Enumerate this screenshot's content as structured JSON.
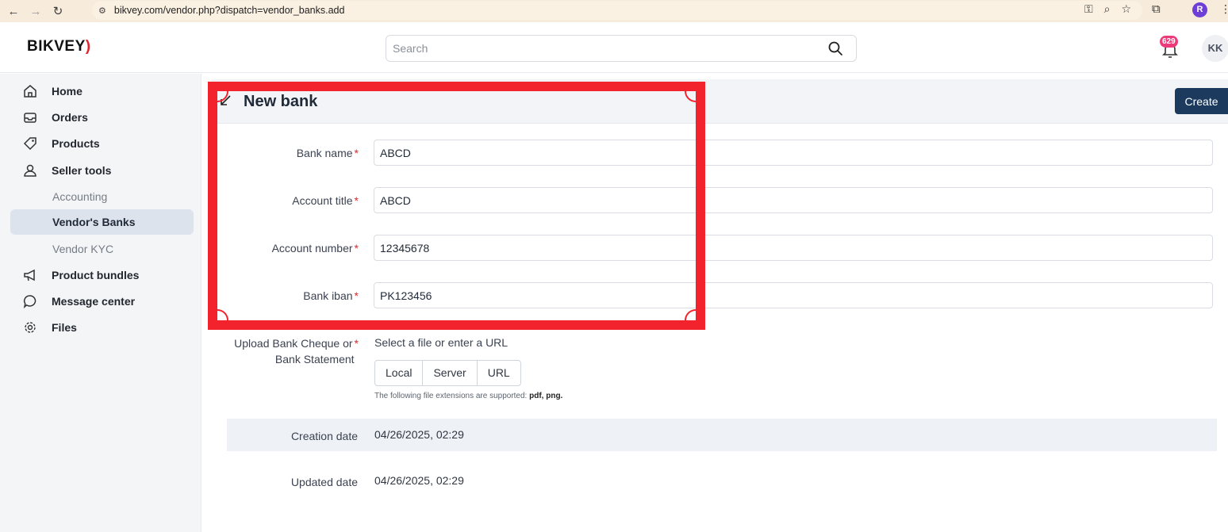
{
  "browser": {
    "url": "bikvey.com/vendor.php?dispatch=vendor_banks.add",
    "profile_initial": "R"
  },
  "header": {
    "logo_text": "BIKVEY",
    "search_placeholder": "Search",
    "notification_count": "629",
    "avatar_initials": "KK"
  },
  "sidebar": {
    "items": [
      {
        "label": "Home",
        "icon": "home-icon"
      },
      {
        "label": "Orders",
        "icon": "inbox-icon"
      },
      {
        "label": "Products",
        "icon": "tag-icon"
      },
      {
        "label": "Seller tools",
        "icon": "user-icon"
      },
      {
        "label": "Accounting"
      },
      {
        "label": "Vendor's Banks",
        "active": true
      },
      {
        "label": "Vendor KYC"
      },
      {
        "label": "Product bundles",
        "icon": "megaphone-icon"
      },
      {
        "label": "Message center",
        "icon": "chat-icon"
      },
      {
        "label": "Files",
        "icon": "gear-icon"
      }
    ]
  },
  "page": {
    "title": "New bank",
    "create_label": "Create"
  },
  "form": {
    "bank_name": {
      "label": "Bank name",
      "value": "ABCD"
    },
    "account_title": {
      "label": "Account title",
      "value": "ABCD"
    },
    "account_number": {
      "label": "Account number",
      "value": "12345678"
    },
    "bank_iban": {
      "label": "Bank iban",
      "value": "PK123456"
    },
    "upload": {
      "label_line1": "Upload Bank Cheque or",
      "label_line2": "Bank Statement",
      "hint": "Select a file or enter a URL",
      "buttons": [
        "Local",
        "Server",
        "URL"
      ],
      "note_prefix": "The following file extensions are supported:",
      "note_exts": "pdf, png."
    },
    "creation_date": {
      "label": "Creation date",
      "value": "04/26/2025, 02:29"
    },
    "updated_date": {
      "label": "Updated date",
      "value": "04/26/2025, 02:29"
    }
  },
  "colors": {
    "annotation": "#f2232d",
    "primary_button": "#1c3a5e",
    "required_marker": "#e0262c",
    "badge": "#ec3a7a"
  }
}
